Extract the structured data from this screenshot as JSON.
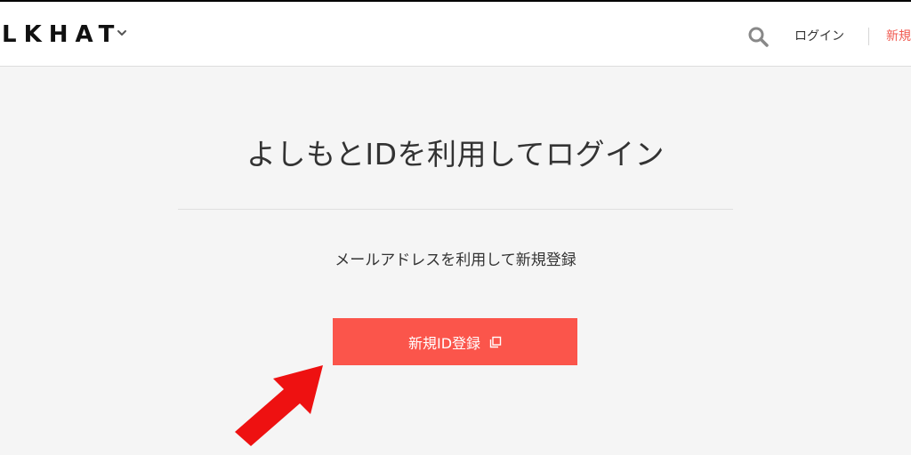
{
  "header": {
    "brand": "LKHAT",
    "search_icon": "search-icon",
    "login_label": "ログイン",
    "register_label": "新規"
  },
  "main": {
    "heading": "よしもとIDを利用してログイン",
    "subtext": "メールアドレスを利用して新規登録",
    "register_button_label": "新規ID登録"
  },
  "colors": {
    "accent": "#fb554b",
    "register_link": "#f05a50",
    "annotation_arrow": "#ee1111",
    "background": "#f5f5f5"
  }
}
